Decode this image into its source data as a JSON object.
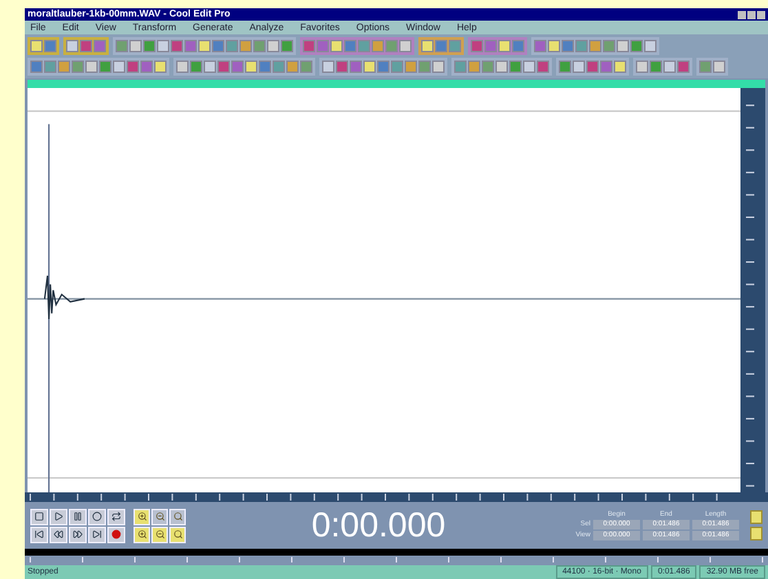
{
  "window": {
    "title": "moraltlauber-1kb-00mm.WAV - Cool Edit Pro"
  },
  "menu": [
    "File",
    "Edit",
    "View",
    "Transform",
    "Generate",
    "Analyze",
    "Favorites",
    "Options",
    "Window",
    "Help"
  ],
  "time_display": "0:00.000",
  "selection": {
    "columns": [
      "Begin",
      "End",
      "Length"
    ],
    "rows": [
      {
        "label": "Sel",
        "values": [
          "0:00.000",
          "0:01.486",
          "0:01.486"
        ]
      },
      {
        "label": "View",
        "values": [
          "0:00.000",
          "0:01.486",
          "0:01.486"
        ]
      }
    ]
  },
  "status_bar": {
    "state": "Stopped",
    "fields": [
      "44100 · 16-bit · Mono",
      "0:01.486",
      "32.90 MB free"
    ]
  }
}
